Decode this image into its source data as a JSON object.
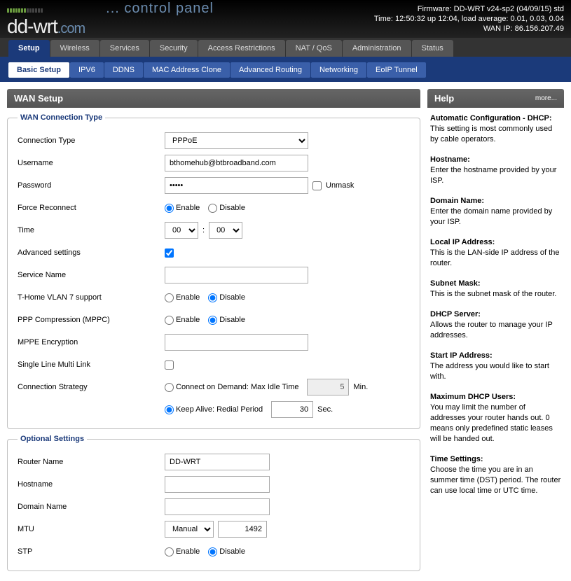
{
  "header": {
    "logo_main": "dd-wrt",
    "logo_ext": ".com",
    "cpanel": "... control panel",
    "firmware": "Firmware: DD-WRT v24-sp2 (04/09/15) std",
    "time": "Time: 12:50:32 up 12:04, load average: 0.01, 0.03, 0.04",
    "wan_ip": "WAN IP: 86.156.207.49"
  },
  "main_tabs": [
    "Setup",
    "Wireless",
    "Services",
    "Security",
    "Access Restrictions",
    "NAT / QoS",
    "Administration",
    "Status"
  ],
  "sub_tabs": [
    "Basic Setup",
    "IPV6",
    "DDNS",
    "MAC Address Clone",
    "Advanced Routing",
    "Networking",
    "EoIP Tunnel"
  ],
  "panel_title": "WAN Setup",
  "wan": {
    "legend": "WAN Connection Type",
    "conn_type_label": "Connection Type",
    "conn_type_value": "PPPoE",
    "username_label": "Username",
    "username_value": "bthomehub@btbroadband.com",
    "password_label": "Password",
    "password_value": "•••••",
    "unmask": "Unmask",
    "force_reconnect": "Force Reconnect",
    "time_label": "Time",
    "time_hh": "00",
    "time_mm": "00",
    "colon": ":",
    "adv_settings": "Advanced settings",
    "service_name": "Service Name",
    "thome": "T-Home VLAN 7 support",
    "ppp_comp": "PPP Compression (MPPC)",
    "mppe": "MPPE Encryption",
    "slml": "Single Line Multi Link",
    "conn_strategy": "Connection Strategy",
    "cod": "Connect on Demand: Max Idle Time",
    "cod_val": "5",
    "min": "Min.",
    "keep_alive": "Keep Alive: Redial Period",
    "ka_val": "30",
    "sec": "Sec.",
    "enable": "Enable",
    "disable": "Disable"
  },
  "opt": {
    "legend": "Optional Settings",
    "router_name_label": "Router Name",
    "router_name_value": "DD-WRT",
    "hostname": "Hostname",
    "domain": "Domain Name",
    "mtu_label": "MTU",
    "mtu_mode": "Manual",
    "mtu_value": "1492",
    "stp": "STP"
  },
  "help": {
    "title": "Help",
    "more": "more...",
    "items": [
      {
        "h": "Automatic Configuration - DHCP:",
        "t": "This setting is most commonly used by cable operators."
      },
      {
        "h": "Hostname:",
        "t": "Enter the hostname provided by your ISP."
      },
      {
        "h": "Domain Name:",
        "t": "Enter the domain name provided by your ISP."
      },
      {
        "h": "Local IP Address:",
        "t": "This is the LAN-side IP address of the router."
      },
      {
        "h": "Subnet Mask:",
        "t": "This is the subnet mask of the router."
      },
      {
        "h": "DHCP Server:",
        "t": "Allows the router to manage your IP addresses."
      },
      {
        "h": "Start IP Address:",
        "t": "The address you would like to start with."
      },
      {
        "h": "Maximum DHCP Users:",
        "t": "You may limit the number of addresses your router hands out. 0 means only predefined static leases will be handed out."
      },
      {
        "h": "Time Settings:",
        "t": "Choose the time you are in an summer time (DST) period. The router can use local time or UTC time."
      }
    ]
  }
}
